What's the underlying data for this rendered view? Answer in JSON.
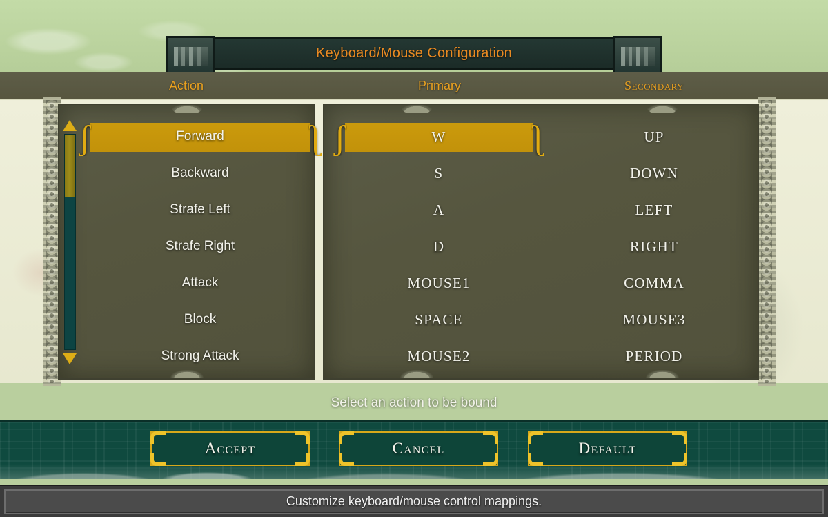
{
  "window": {
    "title": "Keyboard/Mouse Configuration"
  },
  "columns": {
    "action": "Action",
    "primary": "Primary",
    "secondary": "Secondary"
  },
  "scrollbar": {
    "up_icon": "triangle-up-icon",
    "down_icon": "triangle-down-icon"
  },
  "rows": [
    {
      "action": "Forward",
      "primary": "W",
      "secondary": "UP",
      "selected": true
    },
    {
      "action": "Backward",
      "primary": "S",
      "secondary": "DOWN",
      "selected": false
    },
    {
      "action": "Strafe Left",
      "primary": "A",
      "secondary": "LEFT",
      "selected": false
    },
    {
      "action": "Strafe Right",
      "primary": "D",
      "secondary": "RIGHT",
      "selected": false
    },
    {
      "action": "Attack",
      "primary": "MOUSE1",
      "secondary": "COMMA",
      "selected": false
    },
    {
      "action": "Block",
      "primary": "SPACE",
      "secondary": "MOUSE3",
      "selected": false
    },
    {
      "action": "Strong Attack",
      "primary": "MOUSE2",
      "secondary": "PERIOD",
      "selected": false
    }
  ],
  "hint": "Select an action to be bound",
  "buttons": {
    "accept": "Accept",
    "cancel": "Cancel",
    "default": "Default"
  },
  "statusbar": {
    "text": "Customize keyboard/mouse control mappings."
  },
  "colors": {
    "gold_highlight": "#c8960a",
    "title_orange": "#e98a22",
    "header_orange": "#e8a020",
    "panel_bg": "#56563f",
    "green_panel": "#0f4a3f",
    "button_border": "#d7a81a",
    "scroll_track": "#0d4443",
    "scroll_thumb": "#8a7a16",
    "statusbar_bg": "#4b4b4b",
    "sky": "#bdd4a2",
    "parchment": "#eceada"
  }
}
